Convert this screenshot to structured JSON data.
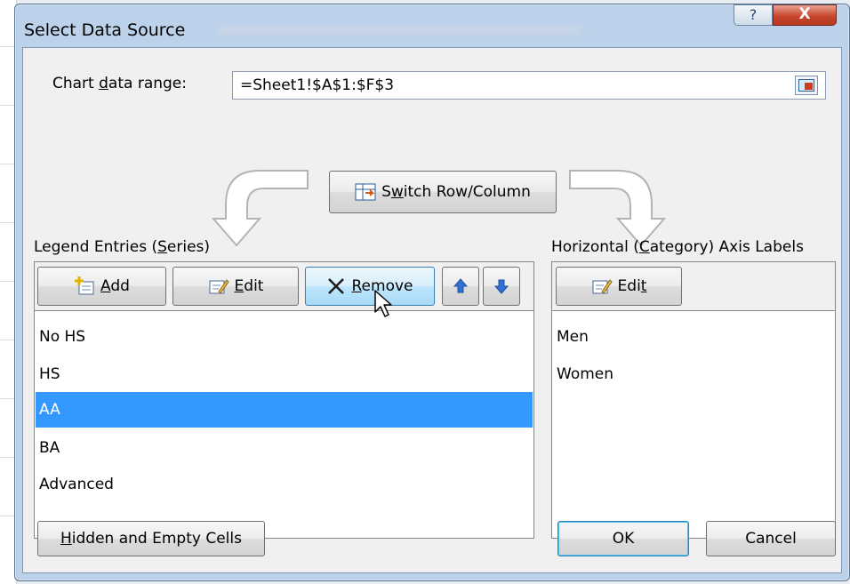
{
  "window": {
    "title": "Select Data Source",
    "help_glyph": "?",
    "close_glyph": "X"
  },
  "data_range": {
    "label_pre": "Chart ",
    "label_key": "d",
    "label_post": "ata range:",
    "value": "=Sheet1!$A$1:$F$3"
  },
  "switch_button": {
    "pre": "S",
    "key": "w",
    "post": "itch Row/Column"
  },
  "legend": {
    "heading_pre": "Legend Entries (",
    "heading_key": "S",
    "heading_post": "eries)",
    "add_key": "A",
    "add_post": "dd",
    "edit_key": "E",
    "edit_post": "dit",
    "remove_key": "R",
    "remove_post": "emove",
    "move_up_icon": "arrow-up-icon",
    "move_down_icon": "arrow-down-icon",
    "items": [
      "No HS",
      "HS",
      "AA",
      "BA",
      "Advanced"
    ],
    "selected_index": 2
  },
  "category": {
    "heading_pre": "Horizontal (",
    "heading_key": "C",
    "heading_post": "ategory) Axis Labels",
    "edit_pre": "Edi",
    "edit_key": "t",
    "items": [
      "Men",
      "Women"
    ]
  },
  "footer": {
    "hidden_key": "H",
    "hidden_post": "idden and Empty Cells",
    "ok": "OK",
    "cancel": "Cancel"
  },
  "colors": {
    "selection": "#3399ff",
    "arrow_icon_blue": "#2f6fd6",
    "close_red": "#c7472e"
  }
}
